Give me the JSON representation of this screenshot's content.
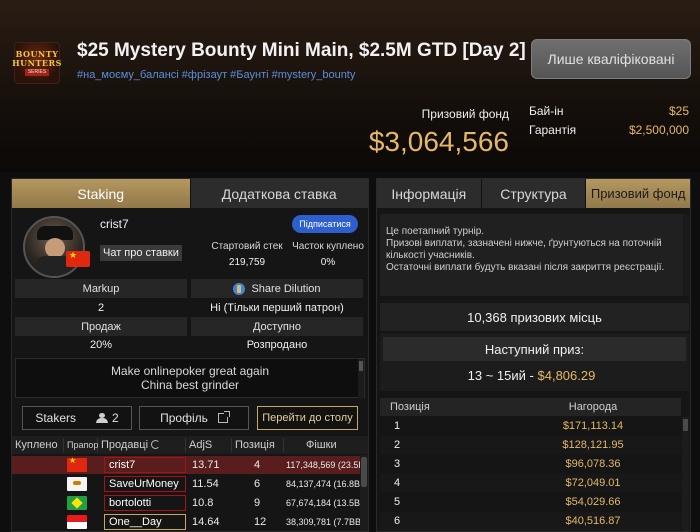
{
  "header": {
    "logo": {
      "line1": "BOUNTY",
      "line2": "HUNTERS",
      "line3": "SERIES"
    },
    "title": "$25 Mystery Bounty Mini Main, $2.5M GTD [Day 2]",
    "tags": "#на_моєму_балансі #фрізаут #Баунті #mystery_bounty",
    "qualified_button": "Лише кваліфіковані",
    "prize_pool_label": "Призовий фонд",
    "prize_pool_value": "$3,064,566",
    "buyin_label": "Бай-ін",
    "buyin_value": "$25",
    "guarantee_label": "Гарантія",
    "guarantee_value": "$2,500,000"
  },
  "left": {
    "tabs": [
      {
        "label": "Staking"
      },
      {
        "label": "Додаткова ставка"
      }
    ],
    "player": {
      "name": "crist7",
      "chat_label": "Чат про ставки",
      "subscribe": "Підписатися"
    },
    "stats": [
      {
        "label": "Стартовий стек",
        "value": "219,759"
      },
      {
        "label": "Часток куплено",
        "value": "0%"
      }
    ],
    "grid": {
      "markup_label": "Markup",
      "markup_value": "2",
      "dilution_label": "Share Dilution",
      "dilution_value": "Ні (Тільки перший патрон)",
      "sale_label": "Продаж",
      "sale_value": "20%",
      "available_label": "Доступно",
      "available_value": "Розпродано"
    },
    "motto": {
      "line1": "Make onlinepoker great again",
      "line2": "China best grinder"
    },
    "buttons": {
      "stakers": "Stakers",
      "stakers_count": "2",
      "profile": "Профіль",
      "goto_table": "Перейти до столу"
    },
    "table": {
      "headers": [
        "Куплено",
        "Прапор",
        "Продавці",
        "AdjS",
        "Позиція",
        "Фішки"
      ],
      "rows": [
        {
          "name": "crist7",
          "adjs": "13.71",
          "pos": "4",
          "chips": "117,348,569 (23.5BB)"
        },
        {
          "name": "SaveUrMoney",
          "adjs": "11.54",
          "pos": "6",
          "chips": "84,137,474 (16.8BB)"
        },
        {
          "name": "bortolotti",
          "adjs": "10.8",
          "pos": "9",
          "chips": "67,674,184 (13.5BB)"
        },
        {
          "name": "One__Day",
          "adjs": "14.64",
          "pos": "12",
          "chips": "38,309,781 (7.7BB)"
        }
      ]
    }
  },
  "right": {
    "tabs": [
      {
        "label": "Інформація"
      },
      {
        "label": "Структура"
      },
      {
        "label": "Призовий фонд"
      }
    ],
    "info": {
      "line1": "Це поетапний турнір.",
      "line2": "Призові виплати, зазначені нижче, ґрунтуються на поточній кількості учасників.",
      "line3": "Остаточні виплати будуть вказані після закриття реєстрації."
    },
    "places": "10,368 призових місць",
    "next_prize_label": "Наступний приз:",
    "next_prize_range": "13 ~ 15ий",
    "next_prize_sep": "-",
    "next_prize_amount": "$4,806.29",
    "payout_headers": {
      "position": "Позиція",
      "prize": "Нагорода"
    },
    "payouts": [
      {
        "pos": "1",
        "amount": "$171,113.14"
      },
      {
        "pos": "2",
        "amount": "$128,121.95"
      },
      {
        "pos": "3",
        "amount": "$96,078.36"
      },
      {
        "pos": "4",
        "amount": "$72,049.01"
      },
      {
        "pos": "5",
        "amount": "$54,029.66"
      },
      {
        "pos": "6",
        "amount": "$40,516.87"
      }
    ]
  },
  "colors": {
    "accent_gold": "#e5b865",
    "tab_active": "#a88c57",
    "link_blue": "#5b8fd9",
    "subscribe_blue": "#2e5fcf",
    "selected_row": "#5a1d1d"
  }
}
